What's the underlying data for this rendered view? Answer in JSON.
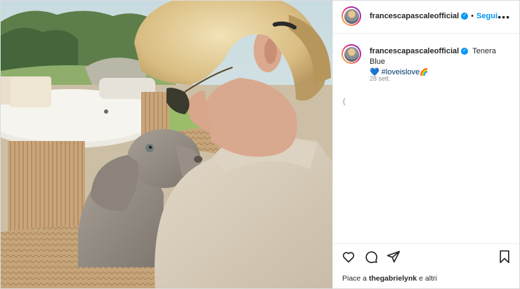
{
  "post": {
    "username": "francescapascaleofficial",
    "follow_label": "Segui",
    "separator": "•",
    "more_label": "•••",
    "caption_username": "francescapascaleofficial",
    "caption_text": "Tenera Blue",
    "caption_hashtag": "#loveislove",
    "caption_time": "28 sett.",
    "likes_prefix": "Piace a ",
    "likes_user": "thegabrielynk",
    "likes_suffix": " e altri",
    "colors": {
      "accent": "#0095f6",
      "text": "#262626",
      "muted": "#8e8e8e",
      "hashtag": "#00376b",
      "heart": "#2b74d8"
    },
    "icons": [
      "heart-icon",
      "comment-icon",
      "share-icon",
      "bookmark-icon",
      "verified-badge-icon",
      "more-icon",
      "rainbow-icon"
    ]
  }
}
